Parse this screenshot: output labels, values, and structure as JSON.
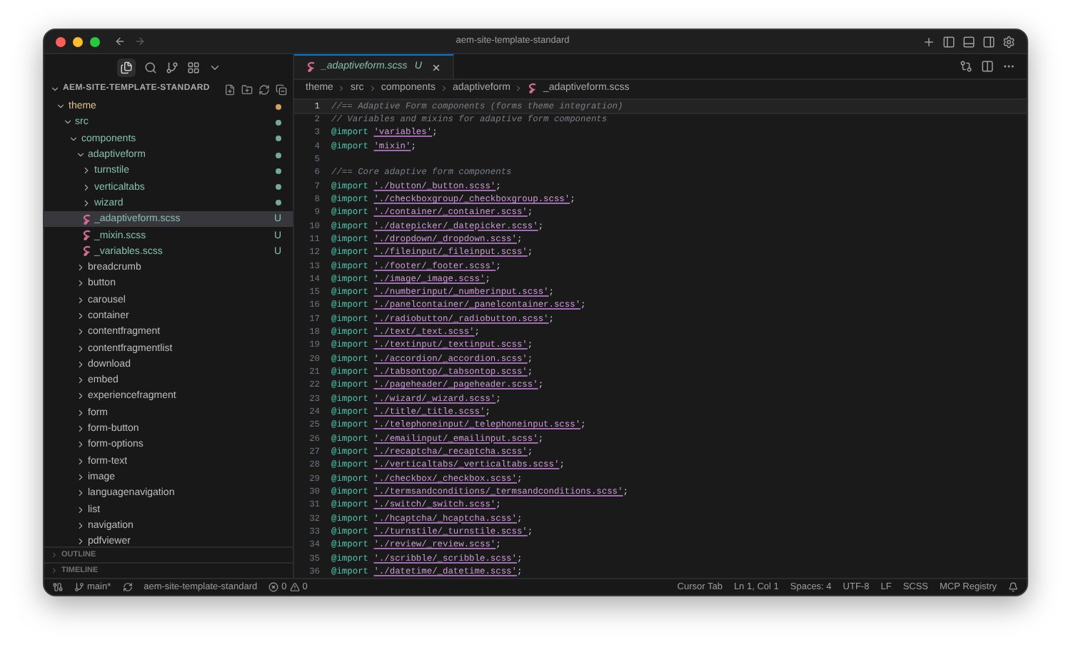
{
  "window": {
    "title": "aem-site-template-standard"
  },
  "sidebar": {
    "header": "AEM-SITE-TEMPLATE-STANDARD",
    "tree": [
      {
        "label": "theme",
        "kind": "folder",
        "expanded": true,
        "modified": true,
        "untracked": false,
        "selected": false,
        "children": [
          {
            "label": "src",
            "kind": "folder",
            "expanded": true,
            "modified": false,
            "untracked": true,
            "selected": false,
            "children": [
              {
                "label": "components",
                "kind": "folder",
                "expanded": true,
                "modified": false,
                "untracked": true,
                "selected": false,
                "children": [
                  {
                    "label": "adaptiveform",
                    "kind": "folder",
                    "expanded": true,
                    "modified": false,
                    "untracked": true,
                    "selected": false,
                    "children": [
                      {
                        "label": "turnstile",
                        "kind": "folder",
                        "expanded": false,
                        "modified": false,
                        "untracked": true,
                        "selected": false
                      },
                      {
                        "label": "verticaltabs",
                        "kind": "folder",
                        "expanded": false,
                        "modified": false,
                        "untracked": true,
                        "selected": false
                      },
                      {
                        "label": "wizard",
                        "kind": "folder",
                        "expanded": false,
                        "modified": false,
                        "untracked": true,
                        "selected": false
                      },
                      {
                        "label": "_adaptiveform.scss",
                        "kind": "file",
                        "modified": false,
                        "untracked": true,
                        "badge": "U",
                        "selected": true
                      },
                      {
                        "label": "_mixin.scss",
                        "kind": "file",
                        "modified": false,
                        "untracked": true,
                        "badge": "U",
                        "selected": false
                      },
                      {
                        "label": "_variables.scss",
                        "kind": "file",
                        "modified": false,
                        "untracked": true,
                        "badge": "U",
                        "selected": false
                      }
                    ]
                  },
                  {
                    "label": "breadcrumb",
                    "kind": "folder",
                    "expanded": false,
                    "modified": false,
                    "untracked": false,
                    "selected": false
                  },
                  {
                    "label": "button",
                    "kind": "folder",
                    "expanded": false,
                    "modified": false,
                    "untracked": false,
                    "selected": false
                  },
                  {
                    "label": "carousel",
                    "kind": "folder",
                    "expanded": false,
                    "modified": false,
                    "untracked": false,
                    "selected": false
                  },
                  {
                    "label": "container",
                    "kind": "folder",
                    "expanded": false,
                    "modified": false,
                    "untracked": false,
                    "selected": false
                  },
                  {
                    "label": "contentfragment",
                    "kind": "folder",
                    "expanded": false,
                    "modified": false,
                    "untracked": false,
                    "selected": false
                  },
                  {
                    "label": "contentfragmentlist",
                    "kind": "folder",
                    "expanded": false,
                    "modified": false,
                    "untracked": false,
                    "selected": false
                  },
                  {
                    "label": "download",
                    "kind": "folder",
                    "expanded": false,
                    "modified": false,
                    "untracked": false,
                    "selected": false
                  },
                  {
                    "label": "embed",
                    "kind": "folder",
                    "expanded": false,
                    "modified": false,
                    "untracked": false,
                    "selected": false
                  },
                  {
                    "label": "experiencefragment",
                    "kind": "folder",
                    "expanded": false,
                    "modified": false,
                    "untracked": false,
                    "selected": false
                  },
                  {
                    "label": "form",
                    "kind": "folder",
                    "expanded": false,
                    "modified": false,
                    "untracked": false,
                    "selected": false
                  },
                  {
                    "label": "form-button",
                    "kind": "folder",
                    "expanded": false,
                    "modified": false,
                    "untracked": false,
                    "selected": false
                  },
                  {
                    "label": "form-options",
                    "kind": "folder",
                    "expanded": false,
                    "modified": false,
                    "untracked": false,
                    "selected": false
                  },
                  {
                    "label": "form-text",
                    "kind": "folder",
                    "expanded": false,
                    "modified": false,
                    "untracked": false,
                    "selected": false
                  },
                  {
                    "label": "image",
                    "kind": "folder",
                    "expanded": false,
                    "modified": false,
                    "untracked": false,
                    "selected": false
                  },
                  {
                    "label": "languagenavigation",
                    "kind": "folder",
                    "expanded": false,
                    "modified": false,
                    "untracked": false,
                    "selected": false
                  },
                  {
                    "label": "list",
                    "kind": "folder",
                    "expanded": false,
                    "modified": false,
                    "untracked": false,
                    "selected": false
                  },
                  {
                    "label": "navigation",
                    "kind": "folder",
                    "expanded": false,
                    "modified": false,
                    "untracked": false,
                    "selected": false
                  },
                  {
                    "label": "pdfviewer",
                    "kind": "folder",
                    "expanded": false,
                    "modified": false,
                    "untracked": false,
                    "selected": false
                  }
                ]
              }
            ]
          }
        ]
      }
    ],
    "panels": [
      {
        "label": "OUTLINE",
        "expanded": false
      },
      {
        "label": "TIMELINE",
        "expanded": false
      }
    ]
  },
  "editor": {
    "tab": {
      "label": "_adaptiveform.scss",
      "badge": "U",
      "selected": true
    },
    "breadcrumb": [
      {
        "label": "theme",
        "kind": "folder"
      },
      {
        "label": "src",
        "kind": "folder"
      },
      {
        "label": "components",
        "kind": "folder"
      },
      {
        "label": "adaptiveform",
        "kind": "folder"
      },
      {
        "label": "_adaptiveform.scss",
        "kind": "file"
      }
    ],
    "lines": [
      {
        "n": "1",
        "kind": "comment",
        "text": "//== Adaptive Form components (forms theme integration)",
        "current": true
      },
      {
        "n": "2",
        "kind": "comment",
        "text": "// Variables and mixins for adaptive form components",
        "current": false
      },
      {
        "n": "3",
        "kind": "import",
        "keyword": "@import",
        "path": "'variables'",
        "end": ";",
        "current": false
      },
      {
        "n": "4",
        "kind": "import",
        "keyword": "@import",
        "path": "'mixin'",
        "end": ";",
        "current": false
      },
      {
        "n": "5",
        "kind": "blank",
        "current": false
      },
      {
        "n": "6",
        "kind": "comment",
        "text": "//== Core adaptive form components",
        "current": false
      },
      {
        "n": "7",
        "kind": "import",
        "keyword": "@import",
        "path": "'./button/_button.scss'",
        "end": ";",
        "current": false
      },
      {
        "n": "8",
        "kind": "import",
        "keyword": "@import",
        "path": "'./checkboxgroup/_checkboxgroup.scss'",
        "end": ";",
        "current": false
      },
      {
        "n": "9",
        "kind": "import",
        "keyword": "@import",
        "path": "'./container/_container.scss'",
        "end": ";",
        "current": false
      },
      {
        "n": "10",
        "kind": "import",
        "keyword": "@import",
        "path": "'./datepicker/_datepicker.scss'",
        "end": ";",
        "current": false
      },
      {
        "n": "11",
        "kind": "import",
        "keyword": "@import",
        "path": "'./dropdown/_dropdown.scss'",
        "end": ";",
        "current": false
      },
      {
        "n": "12",
        "kind": "import",
        "keyword": "@import",
        "path": "'./fileinput/_fileinput.scss'",
        "end": ";",
        "current": false
      },
      {
        "n": "13",
        "kind": "import",
        "keyword": "@import",
        "path": "'./footer/_footer.scss'",
        "end": ";",
        "current": false
      },
      {
        "n": "14",
        "kind": "import",
        "keyword": "@import",
        "path": "'./image/_image.scss'",
        "end": ";",
        "current": false
      },
      {
        "n": "15",
        "kind": "import",
        "keyword": "@import",
        "path": "'./numberinput/_numberinput.scss'",
        "end": ";",
        "current": false
      },
      {
        "n": "16",
        "kind": "import",
        "keyword": "@import",
        "path": "'./panelcontainer/_panelcontainer.scss'",
        "end": ";",
        "current": false
      },
      {
        "n": "17",
        "kind": "import",
        "keyword": "@import",
        "path": "'./radiobutton/_radiobutton.scss'",
        "end": ";",
        "current": false
      },
      {
        "n": "18",
        "kind": "import",
        "keyword": "@import",
        "path": "'./text/_text.scss'",
        "end": ";",
        "current": false
      },
      {
        "n": "19",
        "kind": "import",
        "keyword": "@import",
        "path": "'./textinput/_textinput.scss'",
        "end": ";",
        "current": false
      },
      {
        "n": "20",
        "kind": "import",
        "keyword": "@import",
        "path": "'./accordion/_accordion.scss'",
        "end": ";",
        "current": false
      },
      {
        "n": "21",
        "kind": "import",
        "keyword": "@import",
        "path": "'./tabsontop/_tabsontop.scss'",
        "end": ";",
        "current": false
      },
      {
        "n": "22",
        "kind": "import",
        "keyword": "@import",
        "path": "'./pageheader/_pageheader.scss'",
        "end": ";",
        "current": false
      },
      {
        "n": "23",
        "kind": "import",
        "keyword": "@import",
        "path": "'./wizard/_wizard.scss'",
        "end": ";",
        "current": false
      },
      {
        "n": "24",
        "kind": "import",
        "keyword": "@import",
        "path": "'./title/_title.scss'",
        "end": ";",
        "current": false
      },
      {
        "n": "25",
        "kind": "import",
        "keyword": "@import",
        "path": "'./telephoneinput/_telephoneinput.scss'",
        "end": ";",
        "current": false
      },
      {
        "n": "26",
        "kind": "import",
        "keyword": "@import",
        "path": "'./emailinput/_emailinput.scss'",
        "end": ";",
        "current": false
      },
      {
        "n": "27",
        "kind": "import",
        "keyword": "@import",
        "path": "'./recaptcha/_recaptcha.scss'",
        "end": ";",
        "current": false
      },
      {
        "n": "28",
        "kind": "import",
        "keyword": "@import",
        "path": "'./verticaltabs/_verticaltabs.scss'",
        "end": ";",
        "current": false
      },
      {
        "n": "29",
        "kind": "import",
        "keyword": "@import",
        "path": "'./checkbox/_checkbox.scss'",
        "end": ";",
        "current": false
      },
      {
        "n": "30",
        "kind": "import",
        "keyword": "@import",
        "path": "'./termsandconditions/_termsandconditions.scss'",
        "end": ";",
        "current": false
      },
      {
        "n": "31",
        "kind": "import",
        "keyword": "@import",
        "path": "'./switch/_switch.scss'",
        "end": ";",
        "current": false
      },
      {
        "n": "32",
        "kind": "import",
        "keyword": "@import",
        "path": "'./hcaptcha/_hcaptcha.scss'",
        "end": ";",
        "current": false
      },
      {
        "n": "33",
        "kind": "import",
        "keyword": "@import",
        "path": "'./turnstile/_turnstile.scss'",
        "end": ";",
        "current": false
      },
      {
        "n": "34",
        "kind": "import",
        "keyword": "@import",
        "path": "'./review/_review.scss'",
        "end": ";",
        "current": false
      },
      {
        "n": "35",
        "kind": "import",
        "keyword": "@import",
        "path": "'./scribble/_scribble.scss'",
        "end": ";",
        "current": false
      },
      {
        "n": "36",
        "kind": "import",
        "keyword": "@import",
        "path": "'./datetime/_datetime.scss'",
        "end": ";",
        "current": false
      }
    ]
  },
  "status_bar": {
    "branch": "main*",
    "repository": "aem-site-template-standard",
    "errors": "0",
    "warnings": "0",
    "right": [
      "Cursor Tab",
      "Ln 1, Col 1",
      "Spaces: 4",
      "UTF-8",
      "LF",
      "SCSS",
      "MCP Registry"
    ]
  }
}
